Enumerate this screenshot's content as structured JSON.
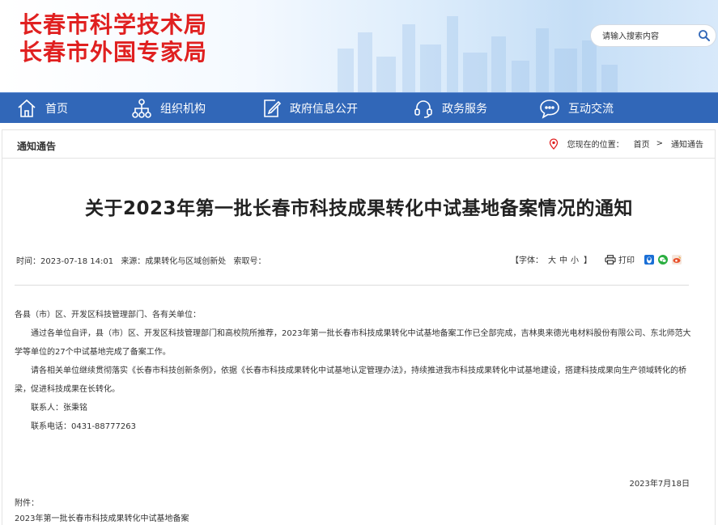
{
  "header": {
    "logo_line1": "长春市科学技术局",
    "logo_line2": "长春市外国专家局",
    "search_placeholder": "请输入搜索内容"
  },
  "nav": {
    "items": [
      {
        "label": "首页",
        "icon": "home-icon"
      },
      {
        "label": "组织机构",
        "icon": "org-chart-icon"
      },
      {
        "label": "政府信息公开",
        "icon": "edit-document-icon"
      },
      {
        "label": "政务服务",
        "icon": "headset-icon"
      },
      {
        "label": "互动交流",
        "icon": "chat-bubble-icon"
      }
    ]
  },
  "breadcrumb": {
    "section_title": "通知通告",
    "location_label": "您现在的位置：",
    "home": "首页",
    "separator": ">",
    "current": "通知通告"
  },
  "article": {
    "title": "关于2023年第一批长春市科技成果转化中试基地备案情况的通知",
    "time_label": "时间：",
    "time_value": "2023-07-18 14:01",
    "source_label": "来源：",
    "source_value": "成果转化与区域创新处",
    "index_label": "索取号：",
    "index_value": "",
    "font_label_open": "【字体：",
    "font_large": "大",
    "font_medium": "中",
    "font_small": "小",
    "font_label_close": "】",
    "print_label": "打印",
    "salutation": "各县（市）区、开发区科技管理部门、各有关单位：",
    "para1": "通过各单位自评，县（市）区、开发区科技管理部门和高校院所推荐，2023年第一批长春市科技成果转化中试基地备案工作已全部完成，吉林奥来德光电材料股份有限公司、东北师范大学等单位的27个中试基地完成了备案工作。",
    "para2": "请各相关单位继续贯彻落实《长春市科技创新条例》，依据《长春市科技成果转化中试基地认定管理办法》，持续推进我市科技成果转化中试基地建设，搭建科技成果向生产领域转化的桥梁，促进科技成果在长转化。",
    "contact_person": "联系人：张秉铭",
    "contact_phone": "联系电话：0431-88777263",
    "date": "2023年7月18日",
    "attachment_label": "附件：",
    "attachment_link": "2023年第一批长春市科技成果转化中试基地备案"
  },
  "colors": {
    "logo_red": "#e02020",
    "nav_blue": "#3167b8",
    "share_qq": "#1a6fd6",
    "share_wechat": "#2aae40",
    "share_weibo": "#e8502a"
  }
}
